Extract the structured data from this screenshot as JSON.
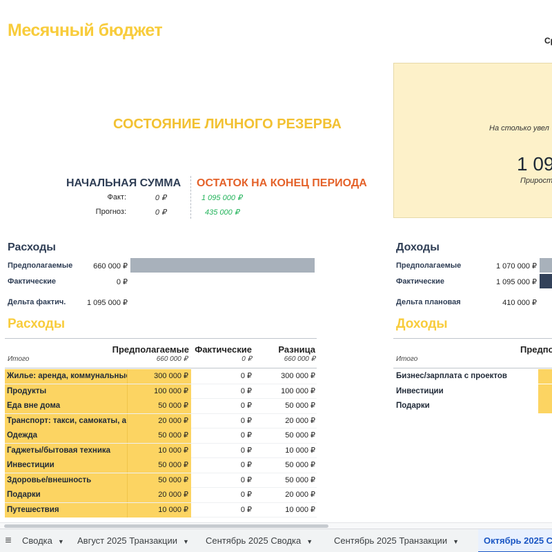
{
  "title": "Месячный бюджет",
  "top_right_cut": "Ср",
  "reserve": {
    "title": "СОСТОЯНИЕ ЛИЧНОГО РЕЗЕРВА",
    "start_heading": "НАЧАЛЬНАЯ СУММА",
    "end_heading": "ОСТАТОК НА КОНЕЦ ПЕРИОДА",
    "fact_label": "Факт:",
    "forecast_label": "Прогноз:",
    "start_fact": "0 ₽",
    "start_forecast": "0 ₽",
    "end_fact": "1 095 000 ₽",
    "end_forecast": "435 000 ₽"
  },
  "panel": {
    "sub": "На столько увел",
    "big": "1 09",
    "small": "Прирост"
  },
  "expenses_summary": {
    "heading": "Расходы",
    "planned_label": "Предполагаемые",
    "planned_value": "660 000 ₽",
    "actual_label": "Фактические",
    "actual_value": "0 ₽",
    "delta_label": "Дельта фактич.",
    "delta_value": "1 095 000 ₽"
  },
  "income_summary": {
    "heading": "Доходы",
    "planned_label": "Предполагаемые",
    "planned_value": "1 070 000 ₽",
    "actual_label": "Фактические",
    "actual_value": "1 095 000 ₽",
    "delta_label": "Дельта плановая",
    "delta_value": "410 000 ₽"
  },
  "expenses_table": {
    "heading": "Расходы",
    "col_planned": "Предполагаемые",
    "col_actual": "Фактические",
    "col_diff": "Разница",
    "total_label": "Итого",
    "total_planned": "660 000 ₽",
    "total_actual": "0 ₽",
    "total_diff": "660 000 ₽",
    "rows": [
      {
        "cat": "Жилье: аренда, коммунальные",
        "plan": "300 000 ₽",
        "fact": "0 ₽",
        "diff": "300 000 ₽"
      },
      {
        "cat": "Продукты",
        "plan": "100 000 ₽",
        "fact": "0 ₽",
        "diff": "100 000 ₽"
      },
      {
        "cat": "Еда вне дома",
        "plan": "50 000 ₽",
        "fact": "0 ₽",
        "diff": "50 000 ₽"
      },
      {
        "cat": "Транспорт: такси, самокаты, а",
        "plan": "20 000 ₽",
        "fact": "0 ₽",
        "diff": "20 000 ₽"
      },
      {
        "cat": "Одежда",
        "plan": "50 000 ₽",
        "fact": "0 ₽",
        "diff": "50 000 ₽"
      },
      {
        "cat": "Гаджеты/бытовая техника",
        "plan": "10 000 ₽",
        "fact": "0 ₽",
        "diff": "10 000 ₽"
      },
      {
        "cat": "Инвестиции",
        "plan": "50 000 ₽",
        "fact": "0 ₽",
        "diff": "50 000 ₽"
      },
      {
        "cat": "Здоровье/внешность",
        "plan": "50 000 ₽",
        "fact": "0 ₽",
        "diff": "50 000 ₽"
      },
      {
        "cat": "Подарки",
        "plan": "20 000 ₽",
        "fact": "0 ₽",
        "diff": "20 000 ₽"
      },
      {
        "cat": "Путешествия",
        "plan": "10 000 ₽",
        "fact": "0 ₽",
        "diff": "10 000 ₽"
      }
    ]
  },
  "income_table": {
    "heading": "Доходы",
    "col_planned": "Предпо",
    "total_label": "Итого",
    "rows": [
      {
        "cat": "Бизнес/зарплата с проектов"
      },
      {
        "cat": "Инвестиции"
      },
      {
        "cat": "Подарки"
      }
    ]
  },
  "progress": {
    "expenses_planned_fraction": 1.0,
    "expenses_actual_fraction": 0.0
  },
  "tabs": [
    {
      "label": "Сводка",
      "active": false
    },
    {
      "label": "Август 2025 Транзакции",
      "active": false
    },
    {
      "label": "Сентябрь 2025 Сводка",
      "active": false
    },
    {
      "label": "Сентябрь 2025 Транзакции",
      "active": false
    },
    {
      "label": "Октябрь 2025 С",
      "active": true
    }
  ],
  "colors": {
    "accent_yellow": "#f8cc3c",
    "orange": "#e4622a",
    "green": "#22b35a",
    "navy": "#2f3e55",
    "active_tab": "#1a56c4"
  }
}
